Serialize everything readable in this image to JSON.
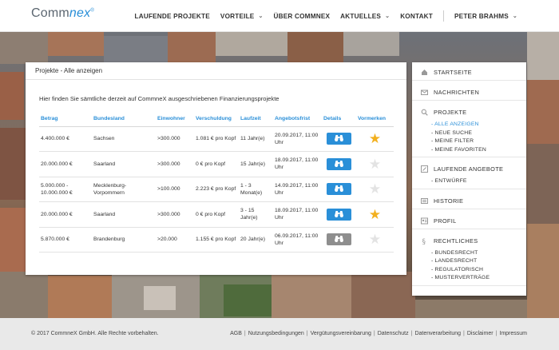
{
  "brand": {
    "logo_a": "Comm",
    "logo_b": "nex",
    "logo_mark": "®"
  },
  "nav": {
    "items": [
      {
        "label": "LAUFENDE PROJEKTE",
        "dropdown": false
      },
      {
        "label": "VORTEILE",
        "dropdown": true
      },
      {
        "label": "ÜBER COMMNEX",
        "dropdown": false
      },
      {
        "label": "AKTUELLES",
        "dropdown": true
      },
      {
        "label": "KONTAKT",
        "dropdown": false
      }
    ],
    "user": "PETER BRAHMS"
  },
  "panel": {
    "title": "Projekte - Alle anzeigen",
    "intro": "Hier finden Sie sämtliche derzeit auf CommneX ausgeschriebenen Finanzierungsprojekte",
    "columns": [
      "Betrag",
      "Bundesland",
      "Einwohner",
      "Verschuldung",
      "Laufzeit",
      "Angebotsfrist",
      "Details",
      "Vormerken"
    ],
    "rows": [
      {
        "betrag": "4.400.000 €",
        "bundesland": "Sachsen",
        "einwohner": ">300.000",
        "verschuldung": "1.081 € pro Kopf",
        "laufzeit": "11 Jahr(e)",
        "frist": "20.09.2017, 11:00 Uhr",
        "details_active": true,
        "vorgemerkt": true
      },
      {
        "betrag": "20.000.000 €",
        "bundesland": "Saarland",
        "einwohner": ">300.000",
        "verschuldung": "0 € pro Kopf",
        "laufzeit": "15 Jahr(e)",
        "frist": "18.09.2017, 11:00 Uhr",
        "details_active": true,
        "vorgemerkt": false
      },
      {
        "betrag": "5.000.000 - 10.000.000 €",
        "bundesland": "Mecklenburg-Vorpommern",
        "einwohner": ">100.000",
        "verschuldung": "2.223 € pro Kopf",
        "laufzeit": "1 - 3 Monat(e)",
        "frist": "14.09.2017, 11:00 Uhr",
        "details_active": true,
        "vorgemerkt": false
      },
      {
        "betrag": "20.000.000 €",
        "bundesland": "Saarland",
        "einwohner": ">300.000",
        "verschuldung": "0 € pro Kopf",
        "laufzeit": "3 - 15 Jahr(e)",
        "frist": "18.09.2017, 11:00 Uhr",
        "details_active": true,
        "vorgemerkt": true
      },
      {
        "betrag": "5.870.000 €",
        "bundesland": "Brandenburg",
        "einwohner": ">20.000",
        "verschuldung": "1.155 € pro Kopf",
        "laufzeit": "20 Jahr(e)",
        "frist": "06.09.2017, 11:00 Uhr",
        "details_active": false,
        "vorgemerkt": false
      }
    ]
  },
  "sidebar": {
    "sections": [
      {
        "label": "STARTSEITE",
        "icon": "home-icon",
        "subs": []
      },
      {
        "label": "NACHRICHTEN",
        "icon": "mail-icon",
        "subs": []
      },
      {
        "label": "PROJEKTE",
        "icon": "search-icon",
        "subs": [
          {
            "label": "- ALLE ANZEIGEN",
            "active": true
          },
          {
            "label": "- NEUE SUCHE",
            "active": false
          },
          {
            "label": "- MEINE FILTER",
            "active": false
          },
          {
            "label": "- MEINE FAVORITEN",
            "active": false
          }
        ]
      },
      {
        "label": "LAUFENDE ANGEBOTE",
        "icon": "edit-icon",
        "subs": [
          {
            "label": "- ENTWÜRFE",
            "active": false
          }
        ]
      },
      {
        "label": "HISTORIE",
        "icon": "history-icon",
        "subs": []
      },
      {
        "label": "PROFIL",
        "icon": "profile-icon",
        "subs": []
      },
      {
        "label": "RECHTLICHES",
        "icon": "paragraph-icon",
        "subs": [
          {
            "label": "- BUNDESRECHT",
            "active": false
          },
          {
            "label": "- LANDESRECHT",
            "active": false
          },
          {
            "label": "- REGULATORISCH",
            "active": false
          },
          {
            "label": "- MUSTERVERTRÄGE",
            "active": false
          }
        ]
      }
    ]
  },
  "footer": {
    "copyright": "© 2017 CommneX GmbH. Alle Rechte vorbehalten.",
    "links": [
      "AGB",
      "Nutzungsbedingungen",
      "Vergütungsvereinbarung",
      "Datenschutz",
      "Datenverarbeitung",
      "Disclaimer",
      "Impressum"
    ]
  },
  "colors": {
    "accent": "#2a8fd8",
    "star": "#f2b01e",
    "footer_bg": "#e9e9e9"
  }
}
